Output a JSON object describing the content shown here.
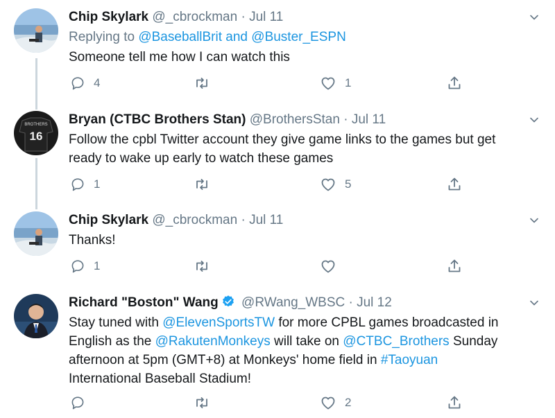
{
  "tweets": [
    {
      "name": "Chip Skylark",
      "handle": "@_cbrockman",
      "dot": "·",
      "date": "Jul 11",
      "reply_prefix": "Replying to ",
      "reply_user1": "@BaseballBrit",
      "reply_and": " and ",
      "reply_user2": "@Buster_ESPN",
      "text": "Someone tell me how I can watch this",
      "replies": "4",
      "retweets": "",
      "likes": "1"
    },
    {
      "name": "Bryan (CTBC Brothers Stan)",
      "handle": "@BrothersStan",
      "dot": "·",
      "date": "Jul 11",
      "text_line1": "Follow the cpbl Twitter account they give game links to the games but get",
      "text_line2": "ready to wake up early to watch these games",
      "replies": "1",
      "retweets": "",
      "likes": "5",
      "jersey_label": "BROTHERS",
      "jersey_number": "16"
    },
    {
      "name": "Chip Skylark",
      "handle": "@_cbrockman",
      "dot": "·",
      "date": "Jul 11",
      "text": "Thanks!",
      "replies": "1",
      "retweets": "",
      "likes": ""
    },
    {
      "name": "Richard \"Boston\" Wang",
      "handle": "@RWang_WBSC",
      "dot": "·",
      "date": "Jul 12",
      "t1": "Stay tuned with ",
      "m1": "@ElevenSportsTW",
      "t2": " for more CPBL games broadcasted in",
      "t3": "English as the ",
      "m2": "@RakutenMonkeys",
      "t4": " will take on ",
      "m3": "@CTBC_Brothers",
      "t5": " Sunday",
      "t6": "afternoon at 5pm (GMT+8) at Monkeys' home field in ",
      "h1": "#Taoyuan",
      "t7": "International Baseball Stadium!",
      "replies": "",
      "retweets": "",
      "likes": "2"
    }
  ],
  "colors": {
    "link": "#1b95e0",
    "secondary": "#657786",
    "thread_line": "#ccd6dd",
    "verified": "#1da1f2"
  },
  "icons": [
    "reply-icon",
    "retweet-icon",
    "like-icon",
    "share-icon",
    "chevron-down-icon",
    "verified-icon"
  ]
}
